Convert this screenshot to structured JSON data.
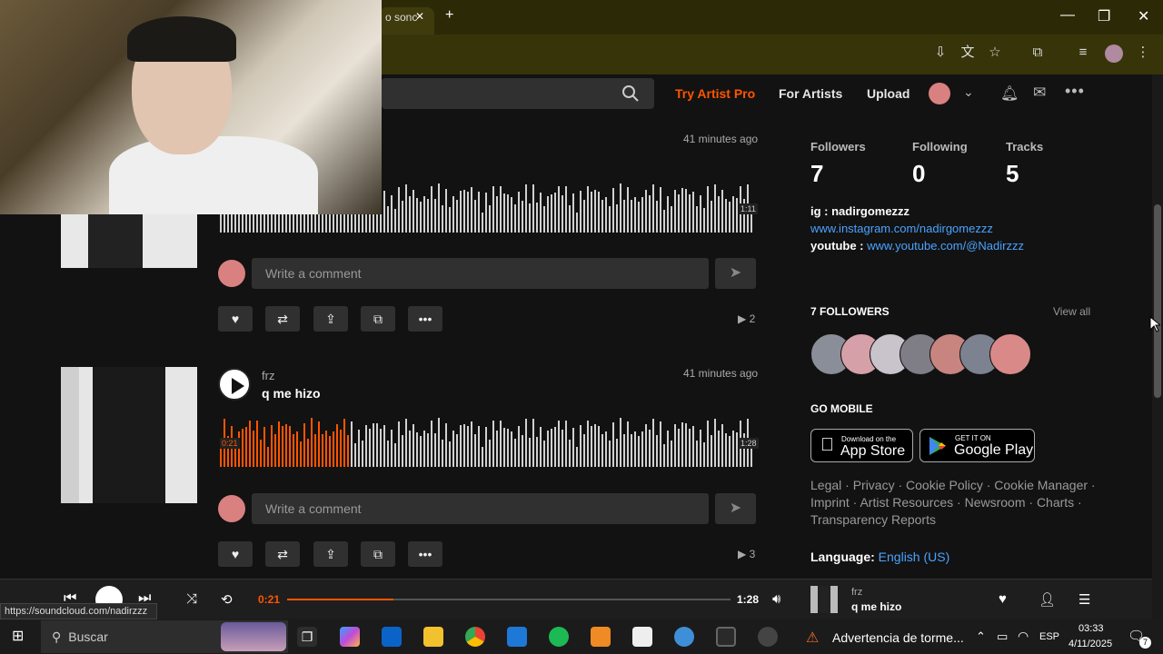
{
  "browser": {
    "tab_text": "o sonc",
    "tab_close": "✕",
    "new_tab": "+",
    "win_min": "—",
    "win_max": "❐",
    "win_close": "✕"
  },
  "header": {
    "try_pro": "Try Artist Pro",
    "for_artists": "For Artists",
    "upload": "Upload"
  },
  "tracks": [
    {
      "time_ago": "41 minutes ago",
      "duration": "1:11",
      "comment_placeholder": "Write a comment",
      "plays": "2"
    },
    {
      "artist": "frz",
      "title": "q me hizo",
      "time_ago": "41 minutes ago",
      "position": "0:21",
      "duration": "1:28",
      "progress_fraction": 0.24,
      "comment_placeholder": "Write a comment",
      "plays": "3"
    }
  ],
  "sidebar": {
    "stats": [
      {
        "label": "Followers",
        "value": "7"
      },
      {
        "label": "Following",
        "value": "0"
      },
      {
        "label": "Tracks",
        "value": "5"
      }
    ],
    "bio_ig": "ig : nadirgomezzz",
    "bio_ig_link": "www.instagram.com/nadirgomezzz",
    "bio_yt_label": "youtube : ",
    "bio_yt_link": "www.youtube.com/@Nadirzzz",
    "followers_heading": "7 FOLLOWERS",
    "view_all": "View all",
    "go_mobile": "GO MOBILE",
    "appstore_small": "Download on the",
    "appstore_big": "App Store",
    "googleplay_small": "GET IT ON",
    "googleplay_big": "Google Play",
    "footer_links": "Legal · Privacy · Cookie Policy · Cookie Manager · Imprint · Artist Resources · Newsroom · Charts · Transparency Reports",
    "language_label": "Language:",
    "language_value": "English (US)"
  },
  "player": {
    "elapsed": "0:21",
    "total": "1:28",
    "progress_fraction": 0.24,
    "artist": "frz",
    "title": "q me hizo"
  },
  "status_url": "https://soundcloud.com/nadirzzz",
  "taskbar": {
    "search": "Buscar",
    "weather": "Advertencia de torme...",
    "lang": "ESP",
    "time": "03:33",
    "date": "4/11/2025",
    "notif_count": "7"
  },
  "colors": {
    "accent": "#ff5500",
    "link": "#4aa3ff"
  }
}
